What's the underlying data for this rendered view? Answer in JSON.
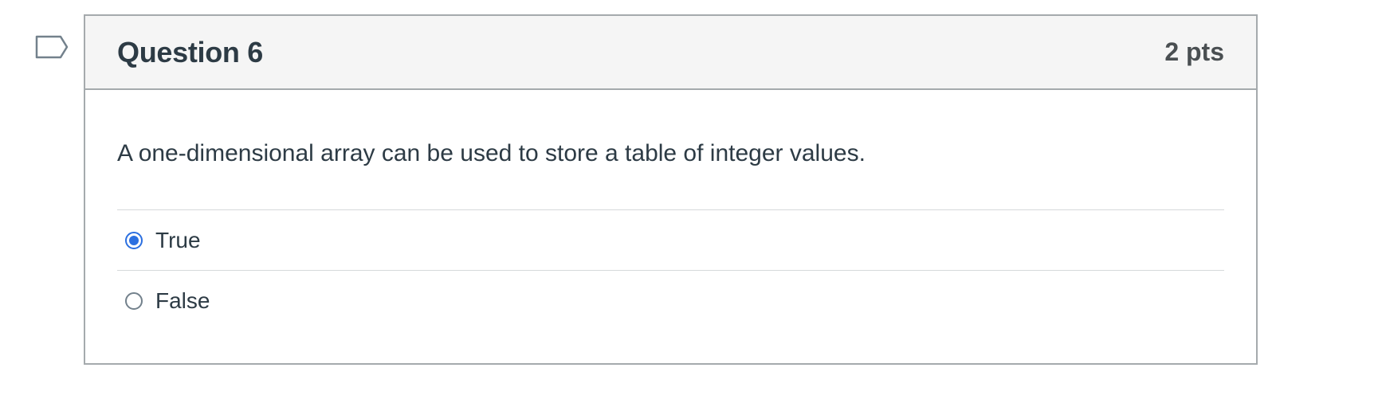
{
  "question": {
    "flag_icon": "bookmark-flag-icon",
    "title": "Question 6",
    "points": "2 pts",
    "text": "A one-dimensional array can be used to store a table of integer values.",
    "answers": [
      {
        "label": "True",
        "selected": true
      },
      {
        "label": "False",
        "selected": false
      }
    ]
  },
  "colors": {
    "accent": "#2b6fe0",
    "header_bg": "#f5f5f5",
    "border": "#a5aaad",
    "text": "#2d3b45"
  }
}
